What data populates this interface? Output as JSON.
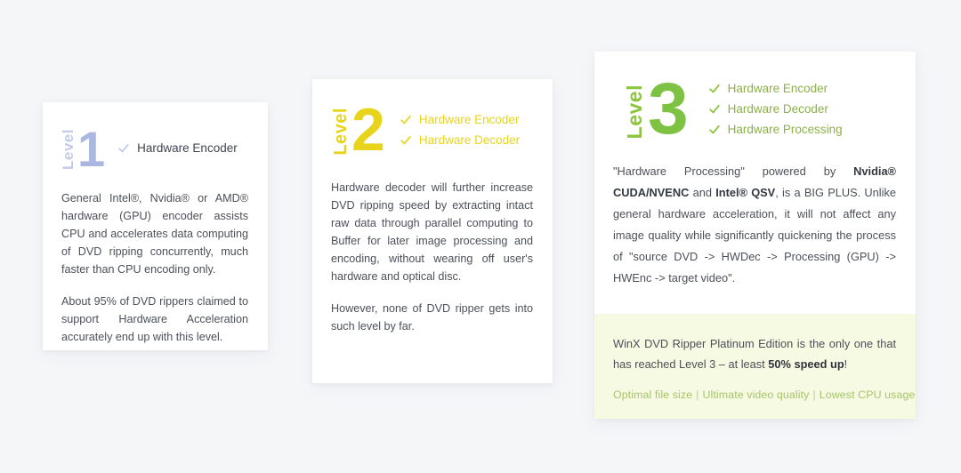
{
  "page": {
    "background_color": "#f5f6f8"
  },
  "cards": [
    {
      "level_word": "Level",
      "level_number": "1",
      "accent_color": "#aab7e0",
      "features": [
        {
          "icon": "check-icon",
          "label": "Hardware Encoder"
        }
      ],
      "paragraphs": [
        "General Intel®, Nvidia® or AMD® hardware (GPU) encoder assists CPU and accelerates data computing of DVD ripping concurrently, much faster than CPU encoding only.",
        "About 95% of DVD rippers claimed to support Hardware Acceleration accurately end up with this level."
      ]
    },
    {
      "level_word": "Level",
      "level_number": "2",
      "accent_color": "#e8d41c",
      "features": [
        {
          "icon": "check-icon",
          "label": "Hardware Encoder"
        },
        {
          "icon": "check-icon",
          "label": "Hardware Decoder"
        }
      ],
      "paragraphs": [
        "Hardware decoder will further increase DVD ripping speed by extracting intact raw data through parallel computing to Buffer for later image processing and encoding, without wearing off user's hardware and optical disc.",
        "However, none of DVD ripper gets into such level by far."
      ]
    },
    {
      "level_word": "Level",
      "level_number": "3",
      "accent_color": "#7dc242",
      "features": [
        {
          "icon": "check-icon",
          "label": "Hardware Encoder"
        },
        {
          "icon": "check-icon",
          "label": "Hardware Decoder"
        },
        {
          "icon": "check-icon",
          "label": "Hardware Processing"
        }
      ],
      "paragraph_html": "\"Hardware Processing\" powered by <b>Nvidia® CUDA/NVENC</b> and <b>Intel® QSV</b>, is a BIG PLUS. Unlike general hardware acceleration, it will not affect any image quality while significantly quickening the process of \"source DVD -&gt; HWDec -&gt; Processing (GPU) -&gt; HWEnc -&gt; target video\".",
      "highlight": {
        "background_color": "#f6fae2",
        "text_html": "WinX DVD Ripper Platinum Edition is the only one that has reached Level 3 – at least <b>50% speed up</b>!",
        "links": [
          "Optimal file size",
          "Ultimate video quality",
          "Lowest CPU usage"
        ],
        "separator": "|",
        "link_color": "#a6c46a"
      }
    }
  ]
}
